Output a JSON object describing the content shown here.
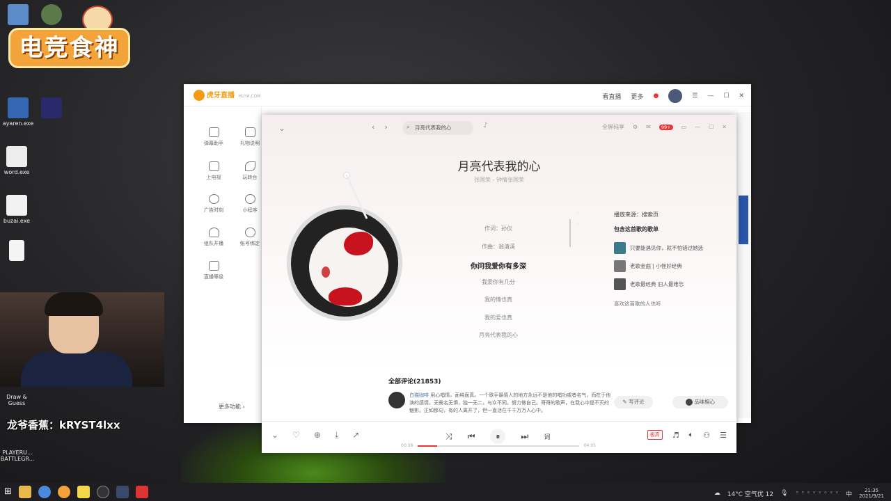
{
  "overlay": {
    "brand": "电竞食神",
    "caption": "龙爷香蕉：kRYST4lxx"
  },
  "desktop": {
    "icons": [
      {
        "label": "",
        "color": "#5b8cc9"
      },
      {
        "label": "",
        "color": "#5a7a4a"
      },
      {
        "label": "ayaren.exe",
        "color": "#3567b5"
      },
      {
        "label": "",
        "color": "#2a2a6a"
      },
      {
        "label": "word.exe",
        "color": "#ededed"
      },
      {
        "label": "buzai.exe",
        "color": "#f2f2f2"
      },
      {
        "label": "",
        "color": "#f4f4f4"
      },
      {
        "label": "Draw & Guess",
        "color": "#888"
      },
      {
        "label": "PLAYERU... BATTLEGR...",
        "color": "#556"
      }
    ]
  },
  "huya": {
    "logo": "虎牙直播",
    "logo_sub": "HUYA.COM",
    "top_actions": [
      "看直播",
      "更多"
    ],
    "sidebar": [
      {
        "label": "弹幕助手"
      },
      {
        "label": "礼物说明"
      },
      {
        "label": "上电视"
      },
      {
        "label": "玩转台"
      },
      {
        "label": "广告时刻"
      },
      {
        "label": "小程序"
      },
      {
        "label": "组队开播"
      },
      {
        "label": "账号绑定"
      },
      {
        "label": "直播等级"
      }
    ],
    "more": "更多功能 ›"
  },
  "player": {
    "search_value": "月亮代表我的心",
    "top_right": [
      "全屏纯享",
      "99+"
    ],
    "song": {
      "title": "月亮代表我的心",
      "subtitle": "张国荣 - 钟情张国荣"
    },
    "lyrics": [
      {
        "text": "作词：孙仪",
        "active": false
      },
      {
        "text": "作曲：翁清溪",
        "active": false
      },
      {
        "text": "你问我爱你有多深",
        "active": true
      },
      {
        "text": "我爱你有几分",
        "active": false
      },
      {
        "text": "我的情也真",
        "active": false
      },
      {
        "text": "我的爱也真",
        "active": false
      },
      {
        "text": "月亮代表我的心",
        "active": false
      }
    ],
    "side": {
      "source": "播放来源：搜索页",
      "heading": "包含这首歌的歌单",
      "playlists": [
        {
          "name": "只要能遇见你，就不怕错过她选"
        },
        {
          "name": "老歌金曲 | 小怪好经典"
        },
        {
          "name": "老歌最经典 旧人最难忘"
        }
      ],
      "also_like": "喜欢这首歌的人也听"
    },
    "comments": {
      "heading": "全部评论(21853)",
      "first": {
        "user": "白猫咖啡",
        "text": "用心唱情，面纯面真。一个歌手最感人的地方永远不是他的唱功或者名气，而在于他演的感情。无需名无惧，独一无二，与众不同。努力做自己。哥哥的歌声，在我心中是不灭的魅影。正如那句，有的人离开了，但一直活在千千万万人心中。"
      },
      "write_btn": "写评论",
      "listen_btn": "品味相心"
    },
    "controls": {
      "time_elapsed": "00:38",
      "time_total": "04:05",
      "progress": 0.12,
      "lyric_btn": "词",
      "quality": "极高"
    }
  },
  "taskbar": {
    "weather": "14°C 空气优 12",
    "time": "21:35",
    "date": "2021/9/21"
  }
}
